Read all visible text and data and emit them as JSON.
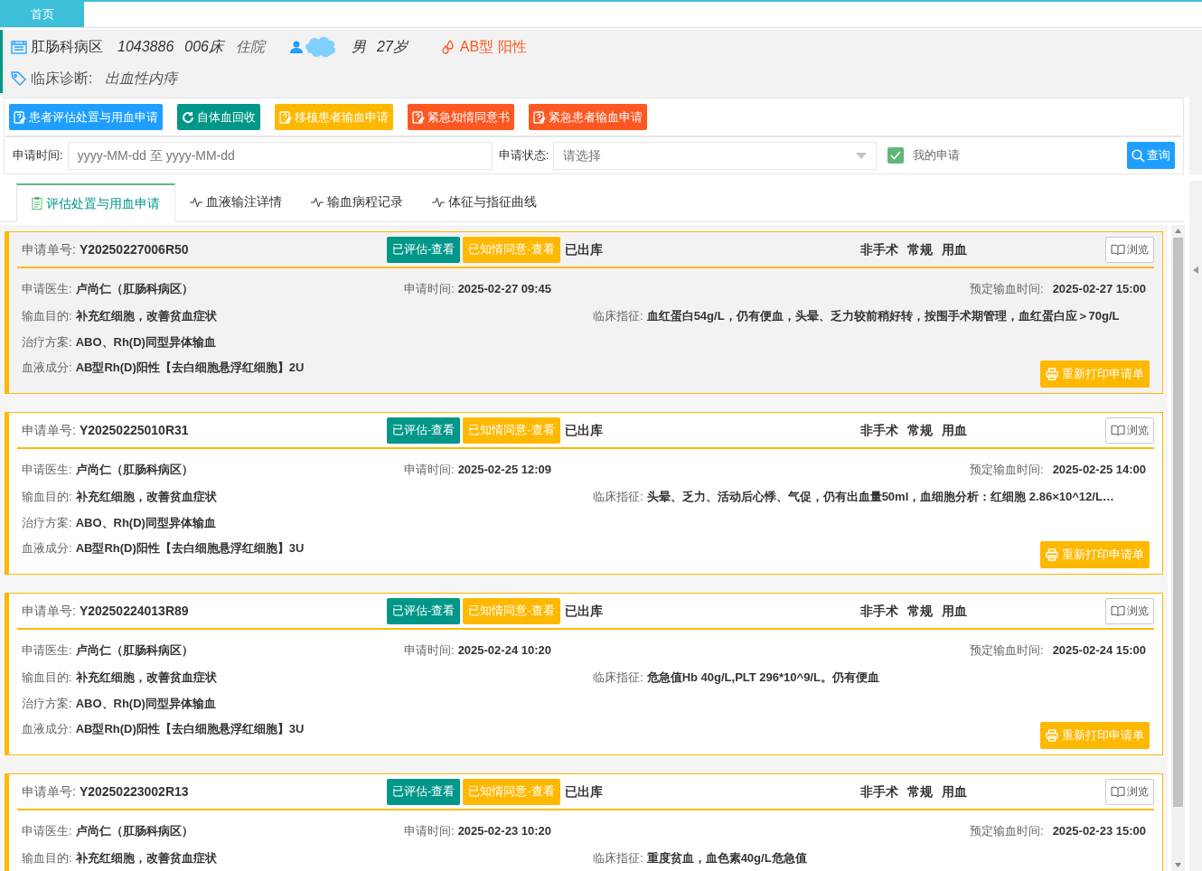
{
  "top_tabs": [
    {
      "label": "首页",
      "selected": true
    }
  ],
  "patient": {
    "ward": "肛肠科病区",
    "inpatient_no": "1043886",
    "bed": "006床",
    "visit_type": "住院",
    "gender": "男",
    "age": "27岁",
    "blood_type": "AB型 阳性",
    "diagnosis_label": "临床诊断:",
    "diagnosis": "出血性内痔"
  },
  "actions": [
    {
      "label": "患者评估处置与用血申请",
      "kind": "form",
      "color": "#1e9fff"
    },
    {
      "label": "自体血回收",
      "kind": "refresh",
      "color": "#009688"
    },
    {
      "label": "移植患者输血申请",
      "kind": "form",
      "color": "#ffb800"
    },
    {
      "label": "紧急知情同意书",
      "kind": "form",
      "color": "#ff5722"
    },
    {
      "label": "紧急患者输血申请",
      "kind": "form",
      "color": "#ff5722"
    }
  ],
  "filter": {
    "time_label": "申请时间:",
    "time_placeholder": "yyyy-MM-dd 至 yyyy-MM-dd",
    "status_label": "申请状态:",
    "status_placeholder": "请选择",
    "mine_label": "我的申请",
    "mine_checked": true,
    "query": "查询"
  },
  "tabs": [
    {
      "label": "评估处置与用血申请",
      "selected": true
    },
    {
      "label": "血液输注详情",
      "selected": false
    },
    {
      "label": "输血病程记录",
      "selected": false
    },
    {
      "label": "体征与指征曲线",
      "selected": false
    }
  ],
  "cards": [
    {
      "selected": true,
      "number_label": "申请单号:",
      "number": "Y20250227006R50",
      "badges": [
        {
          "label": "已评估-查看",
          "color": "#009688"
        },
        {
          "label": "已知情同意-查看",
          "color": "#ffb800"
        }
      ],
      "status": "已出库",
      "tags": [
        "非手术",
        "常规",
        "用血"
      ],
      "browse": "浏览",
      "doctor": {
        "label": "申请医生:",
        "value": "卢尚仁（肛肠科病区）"
      },
      "request_time": {
        "label": "申请时间:",
        "value": "2025-02-27 09:45"
      },
      "scheduled_time": {
        "label": "预定输血时间:",
        "value": "2025-02-27 15:00"
      },
      "purpose": {
        "label": "输血目的:",
        "value": "补充红细胞，改善贫血症状"
      },
      "indication": {
        "label": "临床指征:",
        "value": "血红蛋白54g/L，仍有便血，头晕、乏力较前稍好转，按围手术期管理，血红蛋白应＞70g/L"
      },
      "plan": {
        "label": "治疗方案:",
        "value": "ABO、Rh(D)同型异体输血"
      },
      "component": {
        "label": "血液成分:",
        "value": "AB型Rh(D)阳性【去白细胞悬浮红细胞】2U"
      },
      "print": "重新打印申请单"
    },
    {
      "selected": false,
      "number_label": "申请单号:",
      "number": "Y20250225010R31",
      "badges": [
        {
          "label": "已评估-查看",
          "color": "#009688"
        },
        {
          "label": "已知情同意-查看",
          "color": "#ffb800"
        }
      ],
      "status": "已出库",
      "tags": [
        "非手术",
        "常规",
        "用血"
      ],
      "browse": "浏览",
      "doctor": {
        "label": "申请医生:",
        "value": "卢尚仁（肛肠科病区）"
      },
      "request_time": {
        "label": "申请时间:",
        "value": "2025-02-25 12:09"
      },
      "scheduled_time": {
        "label": "预定输血时间:",
        "value": "2025-02-25 14:00"
      },
      "purpose": {
        "label": "输血目的:",
        "value": "补充红细胞，改善贫血症状"
      },
      "indication": {
        "label": "临床指征:",
        "value": "头晕、乏力、活动后心悸、气促，仍有出血量50ml，血细胞分析：红细胞 2.86×10^12/L…"
      },
      "plan": {
        "label": "治疗方案:",
        "value": "ABO、Rh(D)同型异体输血"
      },
      "component": {
        "label": "血液成分:",
        "value": "AB型Rh(D)阳性【去白细胞悬浮红细胞】3U"
      },
      "print": "重新打印申请单"
    },
    {
      "selected": false,
      "number_label": "申请单号:",
      "number": "Y20250224013R89",
      "badges": [
        {
          "label": "已评估-查看",
          "color": "#009688"
        },
        {
          "label": "已知情同意-查看",
          "color": "#ffb800"
        }
      ],
      "status": "已出库",
      "tags": [
        "非手术",
        "常规",
        "用血"
      ],
      "browse": "浏览",
      "doctor": {
        "label": "申请医生:",
        "value": "卢尚仁（肛肠科病区）"
      },
      "request_time": {
        "label": "申请时间:",
        "value": "2025-02-24 10:20"
      },
      "scheduled_time": {
        "label": "预定输血时间:",
        "value": "2025-02-24 15:00"
      },
      "purpose": {
        "label": "输血目的:",
        "value": "补充红细胞，改善贫血症状"
      },
      "indication": {
        "label": "临床指征:",
        "value": "危急值Hb 40g/L,PLT 296*10^9/L。仍有便血"
      },
      "plan": {
        "label": "治疗方案:",
        "value": "ABO、Rh(D)同型异体输血"
      },
      "component": {
        "label": "血液成分:",
        "value": "AB型Rh(D)阳性【去白细胞悬浮红细胞】3U"
      },
      "print": "重新打印申请单"
    },
    {
      "selected": false,
      "number_label": "申请单号:",
      "number": "Y20250223002R13",
      "badges": [
        {
          "label": "已评估-查看",
          "color": "#009688"
        },
        {
          "label": "已知情同意-查看",
          "color": "#ffb800"
        }
      ],
      "status": "已出库",
      "tags": [
        "非手术",
        "常规",
        "用血"
      ],
      "browse": "浏览",
      "doctor": {
        "label": "申请医生:",
        "value": "卢尚仁（肛肠科病区）"
      },
      "request_time": {
        "label": "申请时间:",
        "value": "2025-02-23 10:20"
      },
      "scheduled_time": {
        "label": "预定输血时间:",
        "value": "2025-02-23 15:00"
      },
      "purpose": {
        "label": "输血目的:",
        "value": "补充红细胞，改善贫血症状"
      },
      "indication": {
        "label": "临床指征:",
        "value": "重度贫血，血色素40g/L危急值"
      }
    }
  ]
}
